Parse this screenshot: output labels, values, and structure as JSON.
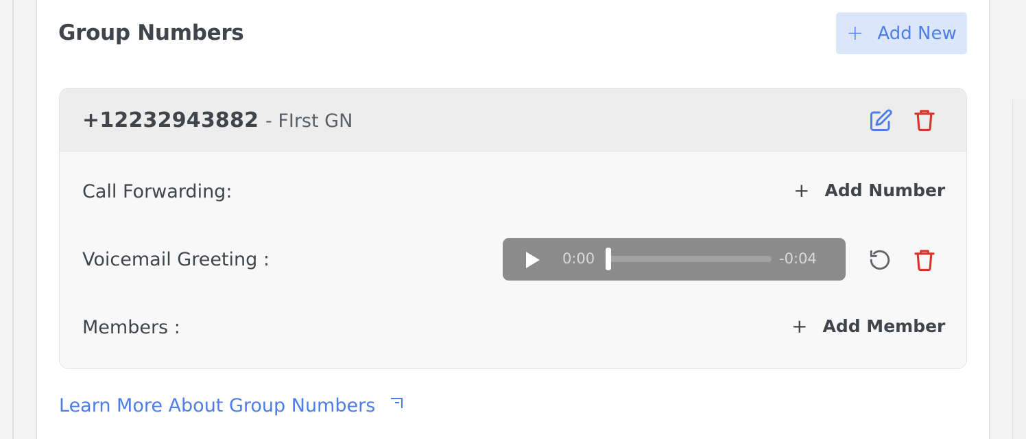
{
  "section": {
    "title": "Group Numbers",
    "add_new_label": "Add New",
    "add_new_icon": "plus-icon"
  },
  "group_number": {
    "phone": "+12232943882",
    "name": "- FIrst GN",
    "rows": {
      "call_forwarding": {
        "label": "Call Forwarding:",
        "action": "Add Number"
      },
      "voicemail": {
        "label": "Voicemail Greeting :",
        "time_current": "0:00",
        "time_remaining": "-0:04",
        "progress": 0
      },
      "members": {
        "label": "Members :",
        "action": "Add Member"
      }
    }
  },
  "footer": {
    "learn_more": "Learn More About Group Numbers",
    "learn_more_icon": "external-link-icon"
  },
  "colors": {
    "accent": "#4d7ee7",
    "danger": "#d9362b",
    "accent_bg": "#dbe6fa"
  }
}
